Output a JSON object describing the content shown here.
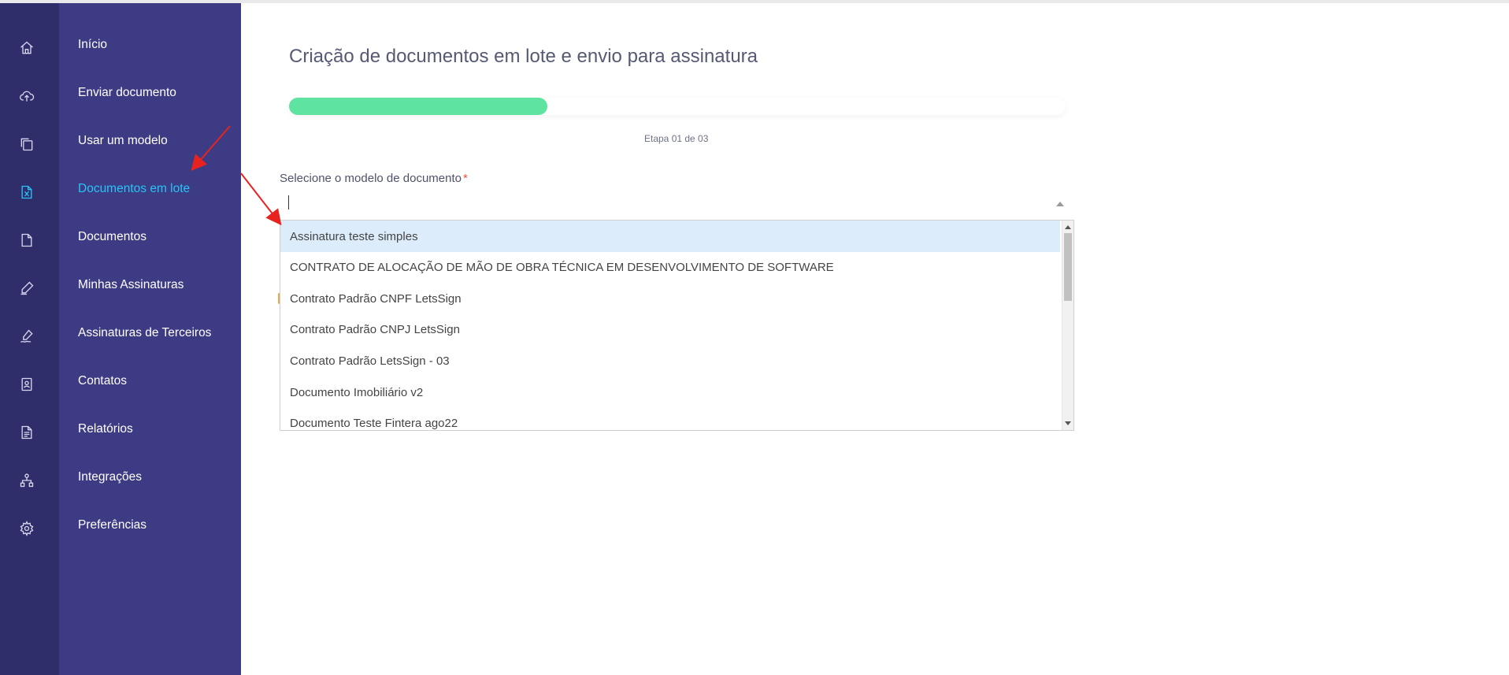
{
  "sidebar": {
    "items": [
      {
        "label": "Início",
        "icon": "home-icon"
      },
      {
        "label": "Enviar documento",
        "icon": "cloud-upload-icon"
      },
      {
        "label": "Usar um modelo",
        "icon": "template-icon"
      },
      {
        "label": "Documentos em lote",
        "icon": "excel-file-icon",
        "active": true
      },
      {
        "label": "Documentos",
        "icon": "document-icon"
      },
      {
        "label": "Minhas Assinaturas",
        "icon": "pen-icon"
      },
      {
        "label": "Assinaturas de Terceiros",
        "icon": "signature-icon"
      },
      {
        "label": "Contatos",
        "icon": "contact-card-icon"
      },
      {
        "label": "Relatórios",
        "icon": "report-icon"
      },
      {
        "label": "Integrações",
        "icon": "network-icon"
      },
      {
        "label": "Preferências",
        "icon": "gear-icon"
      }
    ]
  },
  "main": {
    "title": "Criação de documentos em lote e envio para assinatura",
    "progress": {
      "fraction": 0.333,
      "step_label": "Etapa 01 de 03"
    },
    "field": {
      "label": "Selecione o modelo de documento",
      "required_mark": "*",
      "value": "",
      "options": [
        "Assinatura teste simples",
        "CONTRATO DE ALOCAÇÃO DE MÃO DE OBRA TÉCNICA EM DESENVOLVIMENTO DE SOFTWARE",
        "Contrato Padrão CNPF LetsSign",
        "Contrato Padrão CNPJ LetsSign",
        "Contrato Padrão LetsSign - 03",
        "Documento Imobiliário v2",
        "Documento Teste Fintera ago22"
      ],
      "highlighted_index": 0
    }
  },
  "colors": {
    "sidebar_rail": "#2f2e6b",
    "sidebar_panel": "#3d3b84",
    "active_item": "#29c3f5",
    "progress_fill": "#5fe3a0",
    "option_highlight": "#dcecfb",
    "annotation_arrow": "#e8231f"
  }
}
